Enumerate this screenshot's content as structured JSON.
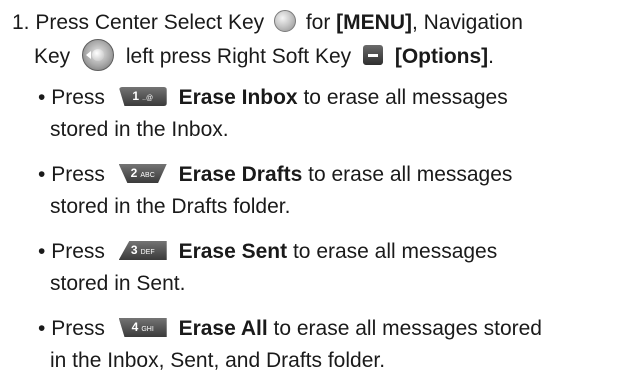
{
  "step": {
    "number": "1.",
    "press": "Press Center Select Key",
    "for": "for",
    "menu": "[MENU]",
    "nav_pre": ", Navigation",
    "key": "Key",
    "left_press": "left press Right Soft Key",
    "options": "[Options]",
    "period": "."
  },
  "bullets": [
    {
      "press": "Press",
      "key_num": "1",
      "key_sub": "..@",
      "title": "Erase Inbox",
      "rest": "to erase all messages",
      "cont": "stored in the Inbox."
    },
    {
      "press": "Press",
      "key_num": "2",
      "key_sub": "ABC",
      "title": "Erase Drafts",
      "rest": "to erase all messages",
      "cont": "stored in the Drafts folder."
    },
    {
      "press": "Press",
      "key_num": "3",
      "key_sub": "DEF",
      "title": "Erase Sent",
      "rest": "to erase all messages",
      "cont": "stored in Sent."
    },
    {
      "press": "Press",
      "key_num": "4",
      "key_sub": "GHI",
      "title": "Erase All",
      "rest": "to erase all messages stored",
      "cont": "in the Inbox, Sent, and Drafts folder."
    }
  ],
  "icons": {
    "center_key": "center-select-key-icon",
    "nav_key": "navigation-key-icon",
    "soft_key": "right-soft-key-icon"
  }
}
